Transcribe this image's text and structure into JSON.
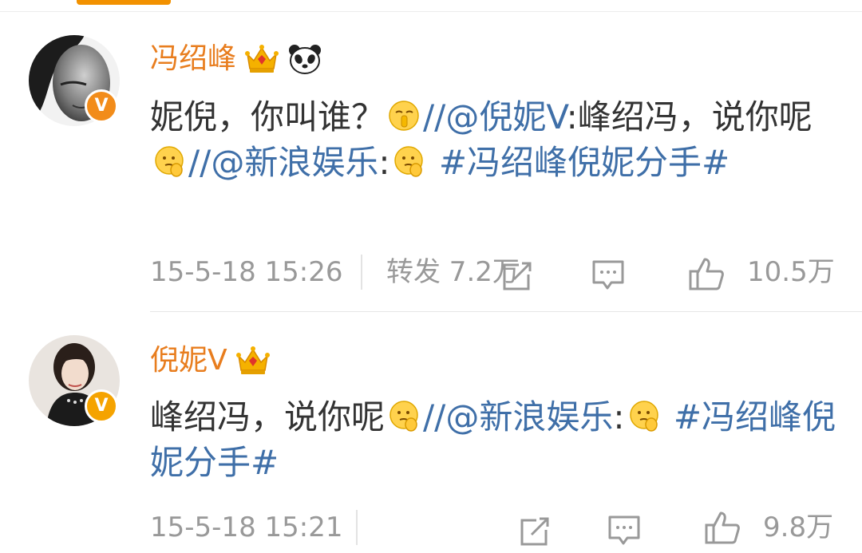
{
  "posts": [
    {
      "username": "冯绍峰",
      "content": {
        "t1": "妮倪，你叫谁？",
        "s1": "//",
        "m1": "@倪妮V",
        "t2": ":峰绍冯，说你呢",
        "s2": "//",
        "m2": "@新浪娱乐",
        "t3": ":",
        "topic": "#冯绍峰倪妮分手#"
      },
      "time": "15-5-18 15:26",
      "repost": "转发 7.2万",
      "likes": "10.5万"
    },
    {
      "username": "倪妮V",
      "content": {
        "t1": "峰绍冯，说你呢",
        "s1": "//",
        "m1": "@新浪娱乐",
        "t2": ":",
        "topic": "#冯绍峰倪妮分手#"
      },
      "time": "15-5-18 15:21",
      "likes": "9.8万"
    }
  ],
  "icons": {
    "crown": "crown-icon",
    "panda": "panda-icon",
    "verified": "verified-badge-icon",
    "share": "share-icon",
    "comment": "comment-icon",
    "like": "like-icon"
  },
  "colors": {
    "username": "#e87d1e",
    "link": "#3f6fa8",
    "meta": "#999999",
    "badge": "#f28c1a"
  }
}
